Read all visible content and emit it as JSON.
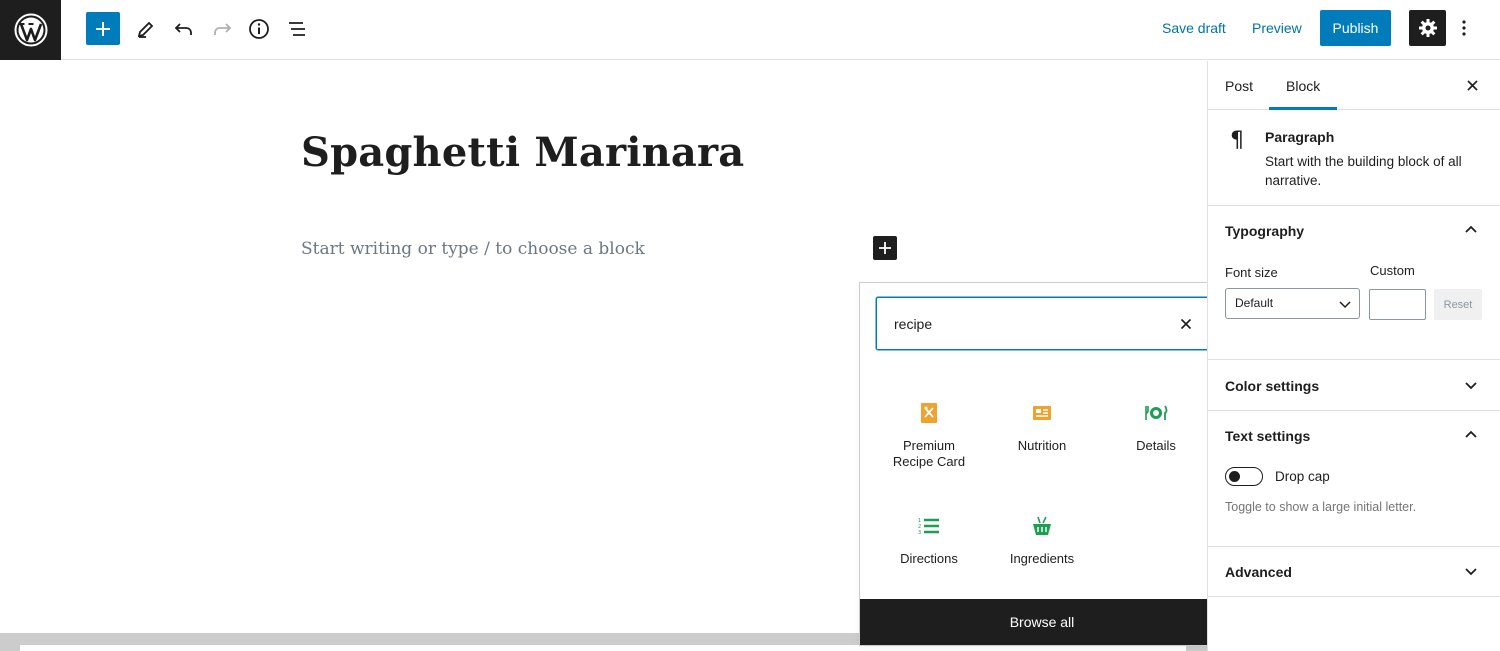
{
  "topbar": {
    "save_draft": "Save draft",
    "preview": "Preview",
    "publish": "Publish",
    "icons": [
      "wordpress-logo-icon",
      "plus-icon",
      "pencil-icon",
      "undo-icon",
      "redo-icon",
      "info-icon",
      "list-view-icon",
      "gear-icon",
      "more-vertical-icon"
    ]
  },
  "editor": {
    "title": "Spaghetti Marinara",
    "placeholder": "Start writing or type / to choose a block"
  },
  "inserter": {
    "search_value": "recipe",
    "blocks": [
      {
        "label": "Premium Recipe Card",
        "icon": "recipe-card-icon",
        "color": "#f0a22e"
      },
      {
        "label": "Nutrition",
        "icon": "nutrition-icon",
        "color": "#f0a22e"
      },
      {
        "label": "Details",
        "icon": "details-icon",
        "color": "#1e9e55"
      },
      {
        "label": "Directions",
        "icon": "directions-icon",
        "color": "#1e9e55"
      },
      {
        "label": "Ingredients",
        "icon": "ingredients-icon",
        "color": "#1e9e55"
      }
    ],
    "browse_all": "Browse all"
  },
  "sidebar": {
    "tabs": [
      {
        "label": "Post"
      },
      {
        "label": "Block",
        "active": true
      }
    ],
    "block_card": {
      "title": "Paragraph",
      "description": "Start with the building block of all narrative."
    },
    "typography": {
      "title": "Typography",
      "font_size_label": "Font size",
      "custom_label": "Custom",
      "font_size_value": "Default",
      "reset": "Reset"
    },
    "color_settings": "Color settings",
    "text_settings": {
      "title": "Text settings",
      "drop_cap_label": "Drop cap",
      "drop_cap_help": "Toggle to show a large initial letter."
    },
    "advanced": "Advanced"
  },
  "colors": {
    "accent": "#007cba",
    "dark": "#1e1e1e"
  }
}
